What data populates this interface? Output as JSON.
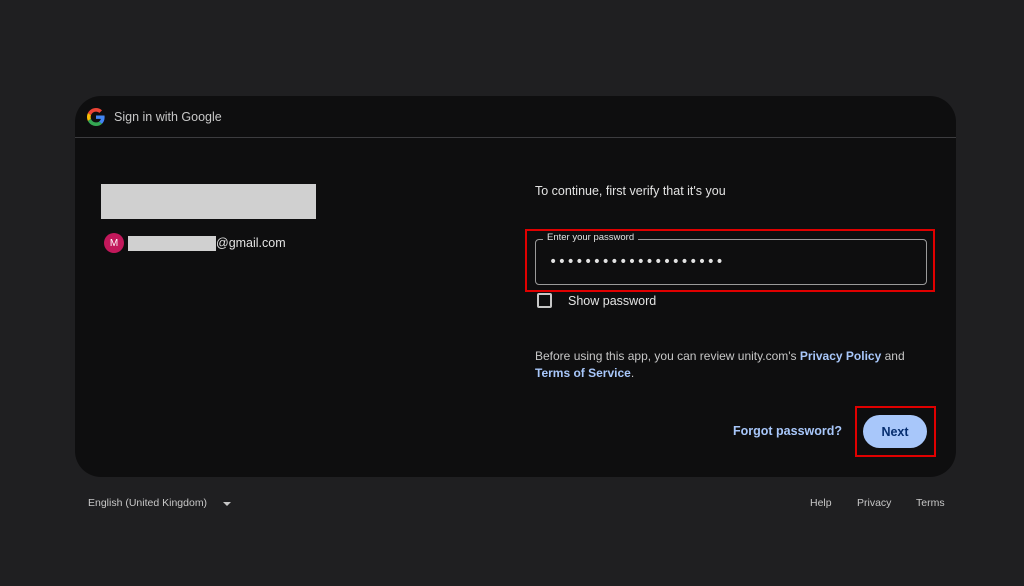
{
  "header": {
    "title": "Sign in with Google",
    "logo_icon": "google-g-icon"
  },
  "account": {
    "avatar_letter": "M",
    "email_suffix": "@gmail.com"
  },
  "form": {
    "subtitle": "To continue, first verify that it's you",
    "password_label": "Enter your password",
    "password_value": "••••••••••••••••••••",
    "show_password_label": "Show password",
    "show_password_checked": false
  },
  "terms": {
    "text_before": "Before using this app, you can review unity.com's ",
    "privacy_link": "Privacy Policy",
    "text_and": " and",
    "terms_link": "Terms of Service",
    "text_end": "."
  },
  "actions": {
    "forgot_label": "Forgot password?",
    "next_label": "Next"
  },
  "footer": {
    "language": "English (United Kingdom)",
    "help": "Help",
    "privacy": "Privacy",
    "terms": "Terms"
  },
  "colors": {
    "background": "#1f1f21",
    "card": "#0e0e0f",
    "link": "#a8c7fa",
    "primary_button": "#a8c7fa",
    "highlight": "#e00000",
    "avatar": "#c2185b"
  }
}
